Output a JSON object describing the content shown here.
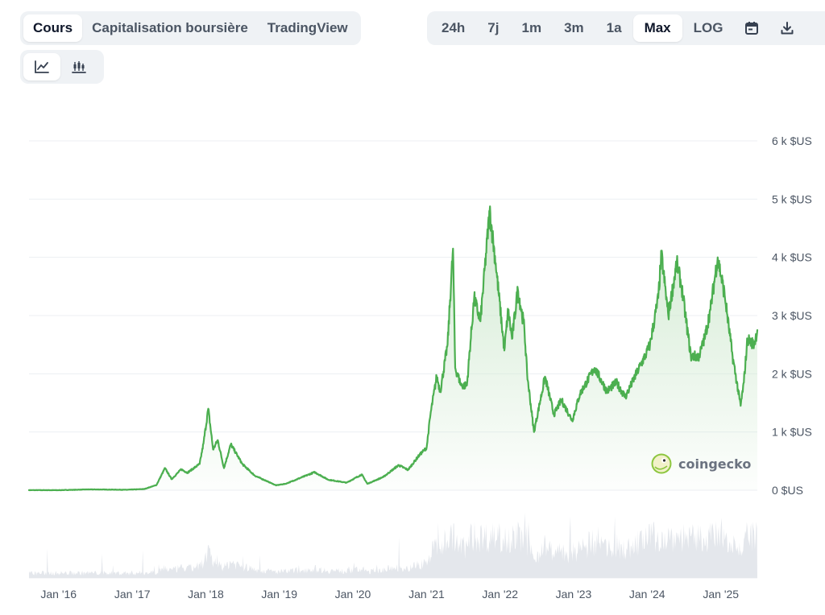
{
  "tabs": [
    {
      "label": "Cours",
      "active": true
    },
    {
      "label": "Capitalisation boursière",
      "active": false
    },
    {
      "label": "TradingView",
      "active": false
    }
  ],
  "ranges": [
    {
      "label": "24h",
      "active": false
    },
    {
      "label": "7j",
      "active": false
    },
    {
      "label": "1m",
      "active": false
    },
    {
      "label": "3m",
      "active": false
    },
    {
      "label": "1a",
      "active": false
    },
    {
      "label": "Max",
      "active": true
    },
    {
      "label": "LOG",
      "active": false
    }
  ],
  "icons": {
    "calendar": "calendar-icon",
    "download": "download-icon",
    "line_chart": "line-chart-icon",
    "candlestick": "candlestick-chart-icon"
  },
  "watermark": "coingecko",
  "colors": {
    "line": "#4caf50",
    "fill_top": "#cfe9cf",
    "grid": "#eceff3",
    "volume": "#e4e7ec"
  },
  "chart_data": {
    "type": "area",
    "y_ticks": [
      0,
      1000,
      2000,
      3000,
      4000,
      5000,
      6000
    ],
    "y_tick_labels": [
      "0 $US",
      "1 k $US",
      "2 k $US",
      "3 k $US",
      "4 k $US",
      "5 k $US",
      "6 k $US"
    ],
    "ylim": [
      0,
      6000
    ],
    "x_ticks": [
      "2016-01-01",
      "2017-01-01",
      "2018-01-01",
      "2019-01-01",
      "2020-01-01",
      "2021-01-01",
      "2022-01-01",
      "2023-01-01",
      "2024-01-01",
      "2025-01-01"
    ],
    "x_tick_labels": [
      "Jan '16",
      "Jan '17",
      "Jan '18",
      "Jan '19",
      "Jan '20",
      "Jan '21",
      "Jan '22",
      "Jan '23",
      "Jan '24",
      "Jan '25"
    ],
    "xlim": [
      "2015-08-07",
      "2025-07-01"
    ],
    "grid": true,
    "series": [
      {
        "points": [
          [
            "2015-08-07",
            2
          ],
          [
            "2016-01-01",
            1
          ],
          [
            "2016-06-01",
            14
          ],
          [
            "2016-12-01",
            8
          ],
          [
            "2017-03-01",
            20
          ],
          [
            "2017-05-01",
            90
          ],
          [
            "2017-06-12",
            380
          ],
          [
            "2017-07-15",
            190
          ],
          [
            "2017-09-01",
            360
          ],
          [
            "2017-10-01",
            300
          ],
          [
            "2017-12-01",
            450
          ],
          [
            "2017-12-20",
            800
          ],
          [
            "2018-01-13",
            1400
          ],
          [
            "2018-02-06",
            700
          ],
          [
            "2018-03-01",
            860
          ],
          [
            "2018-04-01",
            380
          ],
          [
            "2018-05-05",
            790
          ],
          [
            "2018-07-01",
            450
          ],
          [
            "2018-09-01",
            250
          ],
          [
            "2018-12-15",
            85
          ],
          [
            "2019-02-01",
            110
          ],
          [
            "2019-06-25",
            310
          ],
          [
            "2019-09-01",
            180
          ],
          [
            "2019-12-01",
            130
          ],
          [
            "2020-02-14",
            270
          ],
          [
            "2020-03-13",
            110
          ],
          [
            "2020-06-01",
            230
          ],
          [
            "2020-08-15",
            430
          ],
          [
            "2020-10-01",
            350
          ],
          [
            "2020-11-25",
            600
          ],
          [
            "2021-01-01",
            730
          ],
          [
            "2021-01-20",
            1300
          ],
          [
            "2021-02-20",
            1950
          ],
          [
            "2021-03-10",
            1700
          ],
          [
            "2021-04-15",
            2500
          ],
          [
            "2021-05-12",
            4150
          ],
          [
            "2021-05-23",
            2100
          ],
          [
            "2021-06-22",
            1800
          ],
          [
            "2021-07-20",
            1800
          ],
          [
            "2021-08-25",
            3300
          ],
          [
            "2021-09-25",
            2900
          ],
          [
            "2021-11-10",
            4800
          ],
          [
            "2021-12-10",
            3900
          ],
          [
            "2022-01-22",
            2400
          ],
          [
            "2022-02-10",
            3100
          ],
          [
            "2022-03-01",
            2600
          ],
          [
            "2022-03-30",
            3450
          ],
          [
            "2022-05-01",
            2800
          ],
          [
            "2022-05-15",
            2000
          ],
          [
            "2022-06-18",
            1000
          ],
          [
            "2022-08-12",
            1950
          ],
          [
            "2022-09-25",
            1300
          ],
          [
            "2022-11-01",
            1550
          ],
          [
            "2022-12-25",
            1200
          ],
          [
            "2023-02-01",
            1650
          ],
          [
            "2023-04-15",
            2100
          ],
          [
            "2023-06-15",
            1700
          ],
          [
            "2023-08-01",
            1850
          ],
          [
            "2023-09-15",
            1600
          ],
          [
            "2023-11-15",
            2050
          ],
          [
            "2023-12-28",
            2350
          ],
          [
            "2024-01-15",
            2500
          ],
          [
            "2024-02-25",
            3300
          ],
          [
            "2024-03-12",
            4050
          ],
          [
            "2024-04-15",
            3000
          ],
          [
            "2024-05-27",
            3900
          ],
          [
            "2024-06-20",
            3500
          ],
          [
            "2024-08-05",
            2300
          ],
          [
            "2024-09-15",
            2300
          ],
          [
            "2024-10-15",
            2650
          ],
          [
            "2024-11-10",
            3100
          ],
          [
            "2024-12-16",
            4000
          ],
          [
            "2025-01-20",
            3350
          ],
          [
            "2025-02-28",
            2300
          ],
          [
            "2025-04-09",
            1450
          ],
          [
            "2025-04-25",
            1850
          ],
          [
            "2025-05-13",
            2600
          ],
          [
            "2025-06-15",
            2500
          ],
          [
            "2025-07-01",
            2750
          ]
        ]
      }
    ]
  }
}
